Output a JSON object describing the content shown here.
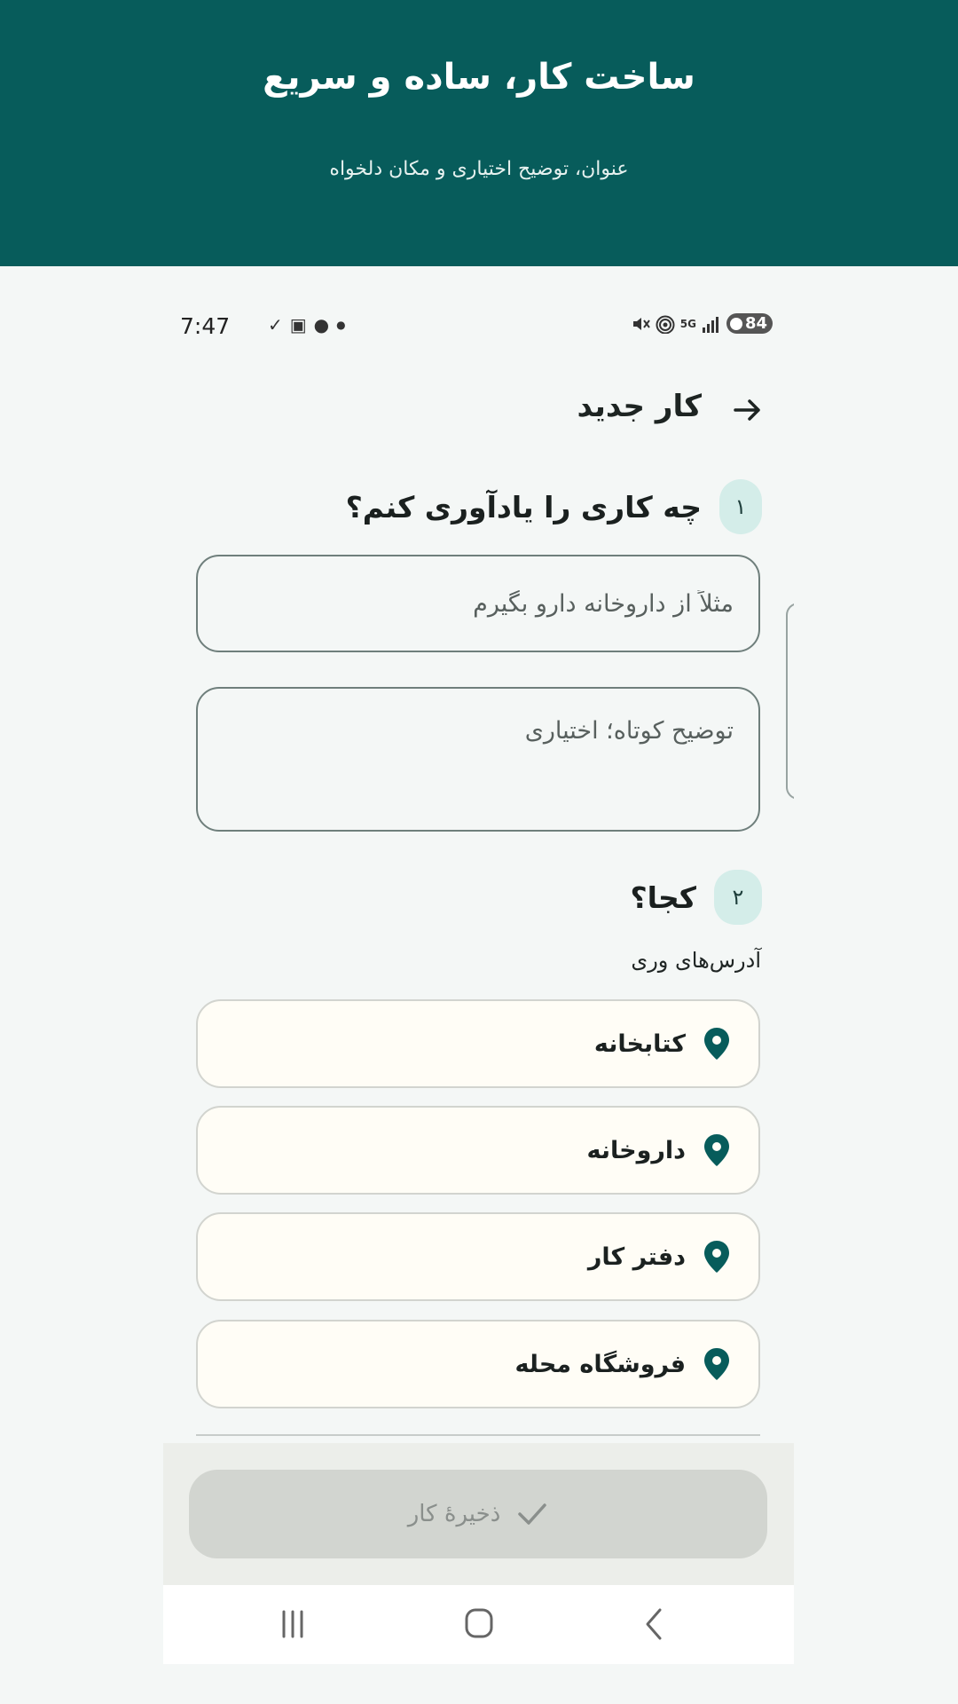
{
  "hero": {
    "title": "ساخت کار، ساده و سریع",
    "subtitle": "عنوان، توضیح اختیاری و مکان دلخواه"
  },
  "status_bar": {
    "time": "7:47",
    "battery": "84",
    "network_label": "5G"
  },
  "appbar": {
    "title": "کار جدید",
    "back_icon": "arrow-right-icon"
  },
  "step1": {
    "badge": "۱",
    "title": "چه کاری را یادآوری کنم؟",
    "title_placeholder": "مثلاً از داروخانه دارو بگیرم",
    "title_value": "",
    "desc_placeholder": "توضیح کوتاه؛ اختیاری",
    "desc_value": ""
  },
  "step2": {
    "badge": "۲",
    "title": "کجا؟",
    "addresses_label": "آدرس‌های وری",
    "locations": [
      {
        "name": "کتابخانه",
        "icon": "location-pin-icon"
      },
      {
        "name": "داروخانه",
        "icon": "location-pin-icon"
      },
      {
        "name": "دفتر کار",
        "icon": "location-pin-icon"
      },
      {
        "name": "فروشگاه محله",
        "icon": "location-pin-icon"
      }
    ]
  },
  "save": {
    "label": "ذخیرهٔ کار",
    "icon": "check-icon"
  },
  "colors": {
    "primary": "#075c5b",
    "badge_bg": "#d4ede9",
    "card_bg": "#fffdf6",
    "disabled_button": "#d2d5d0"
  }
}
